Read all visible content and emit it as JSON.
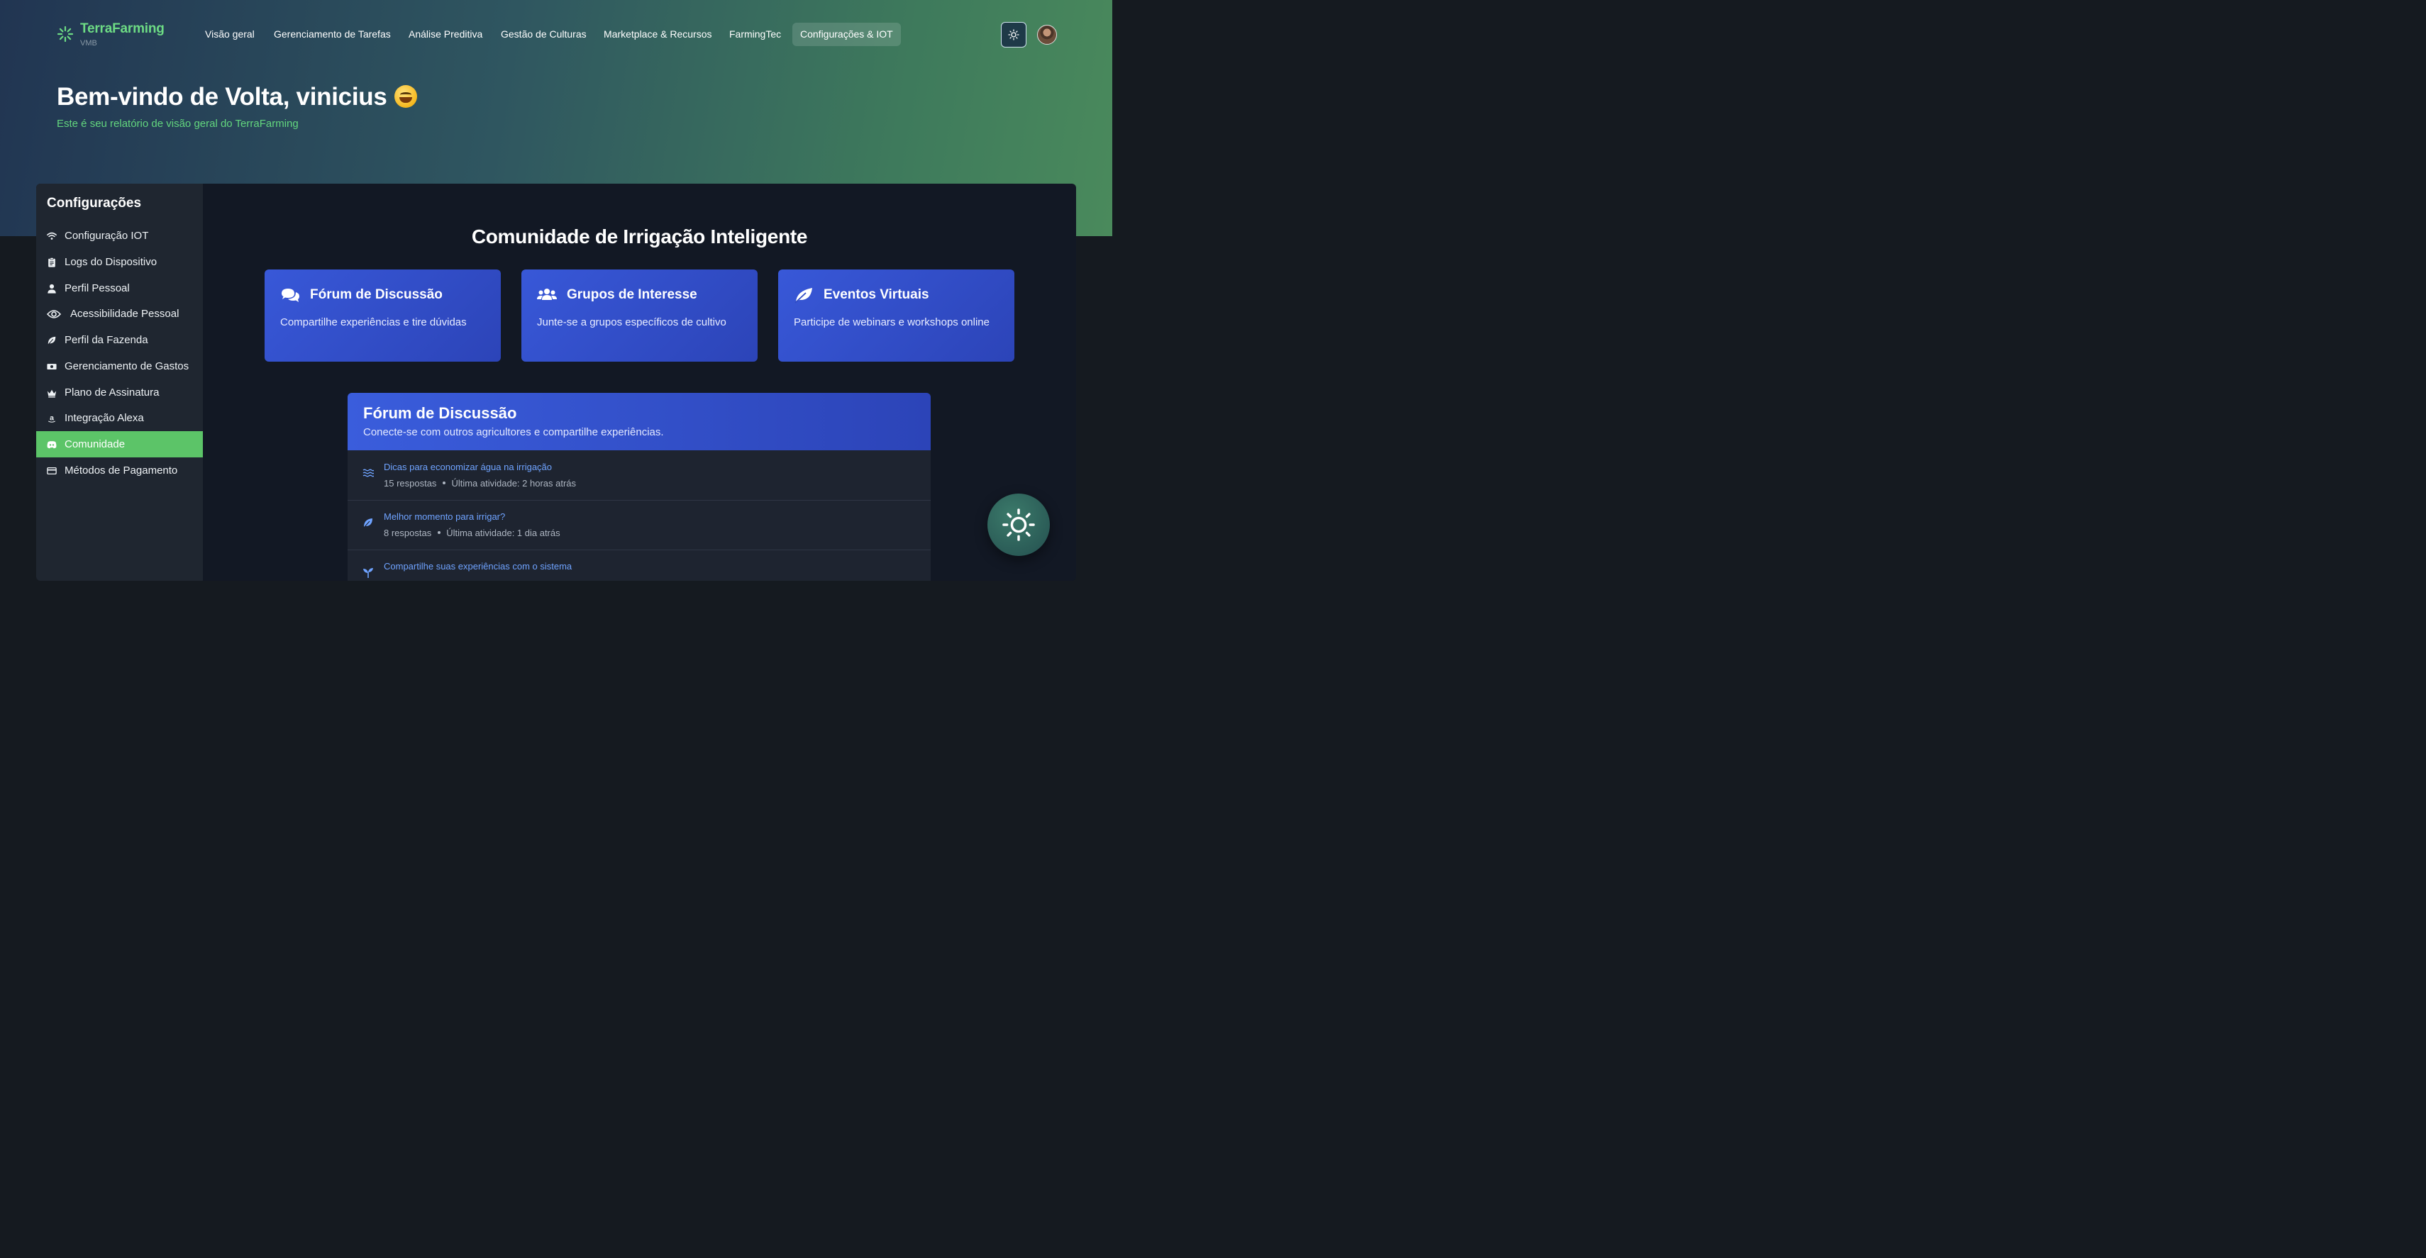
{
  "brand": {
    "name": "TerraFarming",
    "sub": "VMB"
  },
  "nav": [
    {
      "label": "Visão geral"
    },
    {
      "label": "Gerenciamento de Tarefas"
    },
    {
      "label": "Análise Preditiva"
    },
    {
      "label": "Gestão de Culturas"
    },
    {
      "label": "Marketplace & Recursos"
    },
    {
      "label": "FarmingTec"
    },
    {
      "label": "Configurações & IOT",
      "active": true
    }
  ],
  "hero": {
    "title": "Bem-vindo de Volta, vinicius",
    "subtitle": "Este é seu relatório de visão geral do TerraFarming"
  },
  "sidebar": {
    "title": "Configurações",
    "items": [
      {
        "label": "Configuração IOT",
        "icon": "wifi-icon"
      },
      {
        "label": "Logs do Dispositivo",
        "icon": "clipboard-icon"
      },
      {
        "label": "Perfil Pessoal",
        "icon": "user-icon"
      },
      {
        "label": "Acessibilidade Pessoal",
        "icon": "eye-icon"
      },
      {
        "label": "Perfil da Fazenda",
        "icon": "leaf-icon"
      },
      {
        "label": "Gerenciamento de Gastos",
        "icon": "money-icon"
      },
      {
        "label": "Plano de Assinatura",
        "icon": "crown-icon"
      },
      {
        "label": "Integração Alexa",
        "icon": "amazon-icon"
      },
      {
        "label": "Comunidade",
        "icon": "discord-icon",
        "active": true
      },
      {
        "label": "Métodos de Pagamento",
        "icon": "credit-card-icon"
      }
    ]
  },
  "main": {
    "title": "Comunidade de Irrigação Inteligente",
    "cards": [
      {
        "title": "Fórum de Discussão",
        "desc": "Compartilhe experiências e tire dúvidas",
        "icon": "comments-icon"
      },
      {
        "title": "Grupos de Interesse",
        "desc": "Junte-se a grupos específicos de cultivo",
        "icon": "users-icon"
      },
      {
        "title": "Eventos Virtuais",
        "desc": "Participe de webinars e workshops online",
        "icon": "feather-icon"
      }
    ],
    "forum": {
      "title": "Fórum de Discussão",
      "subtitle": "Conecte-se com outros agricultores e compartilhe experiências.",
      "topics": [
        {
          "title": "Dicas para economizar água na irrigação",
          "replies": "15 respostas",
          "activity": "Última atividade: 2 horas atrás",
          "icon": "water-icon"
        },
        {
          "title": "Melhor momento para irrigar?",
          "replies": "8 respostas",
          "activity": "Última atividade: 1 dia atrás",
          "icon": "leaf-icon"
        },
        {
          "title": "Compartilhe suas experiências com o sistema",
          "replies": "",
          "activity": "",
          "icon": "seedling-icon"
        }
      ]
    }
  },
  "colors": {
    "accent": "#5cc468",
    "brand": "#6ddb84",
    "card": "#3858d8",
    "link": "#6fa3ff"
  }
}
